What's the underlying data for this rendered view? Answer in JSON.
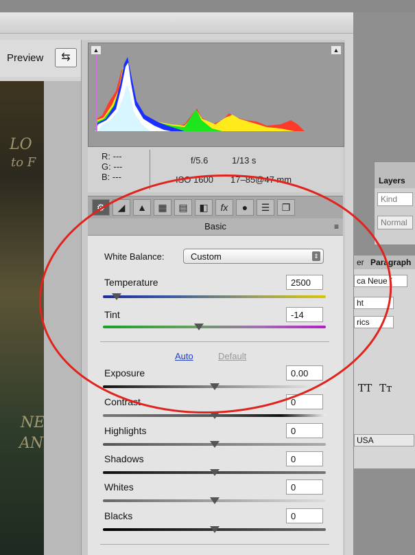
{
  "window": {
    "preview_label": "Preview",
    "preview_button_icon": "⇆"
  },
  "photo_text": {
    "line1": "LO",
    "line2": "to F",
    "line3": "NE",
    "line4": "AN"
  },
  "histogram": {
    "clip_shadow_icon": "▲",
    "clip_highlight_icon": "▲"
  },
  "info": {
    "r_label": "R:",
    "r_value": "---",
    "g_label": "G:",
    "g_value": "---",
    "b_label": "B:",
    "b_value": "---",
    "aperture": "f/5.6",
    "shutter": "1/13 s",
    "iso": "ISO 1600",
    "lens": "17–85@47 mm"
  },
  "tabs": [
    {
      "icon": "⚙",
      "name": "basic"
    },
    {
      "icon": "◢",
      "name": "tone-curve"
    },
    {
      "icon": "▲",
      "name": "detail"
    },
    {
      "icon": "▦",
      "name": "hsl"
    },
    {
      "icon": "▤",
      "name": "split-toning"
    },
    {
      "icon": "◧",
      "name": "lens-corrections"
    },
    {
      "icon": "fx",
      "name": "effects"
    },
    {
      "icon": "●",
      "name": "camera-calibration"
    },
    {
      "icon": "☰",
      "name": "presets"
    },
    {
      "icon": "❐",
      "name": "snapshots"
    }
  ],
  "panel": {
    "title": "Basic",
    "menu_icon": "≡"
  },
  "white_balance": {
    "label": "White Balance:",
    "value": "Custom",
    "arrow": "⇕"
  },
  "temperature": {
    "label": "Temperature",
    "value": "2500",
    "level": 0.06
  },
  "tint": {
    "label": "Tint",
    "value": "-14",
    "level": 0.43
  },
  "links": {
    "auto": "Auto",
    "default": "Default"
  },
  "sliders": [
    {
      "label": "Exposure",
      "value": "0.00",
      "level": 0.5
    },
    {
      "label": "Contrast",
      "value": "0",
      "level": 0.5
    },
    {
      "label": "Highlights",
      "value": "0",
      "level": 0.5
    },
    {
      "label": "Shadows",
      "value": "0",
      "level": 0.5
    },
    {
      "label": "Whites",
      "value": "0",
      "level": 0.5
    },
    {
      "label": "Blacks",
      "value": "0",
      "level": 0.5
    }
  ],
  "layers_panel": {
    "title": "Layers",
    "search": "Kind",
    "blend": "Normal"
  },
  "para_panel": {
    "tab1": "er",
    "tab2": "Paragraph",
    "font": "ca Neue (",
    "style1": "ht",
    "style2": "rics",
    "lang": "USA",
    "tt1": "TT",
    "tt2": "Tт"
  },
  "colors": {
    "accent_red_circle": "#e0231c",
    "link_blue": "#2040c0"
  }
}
